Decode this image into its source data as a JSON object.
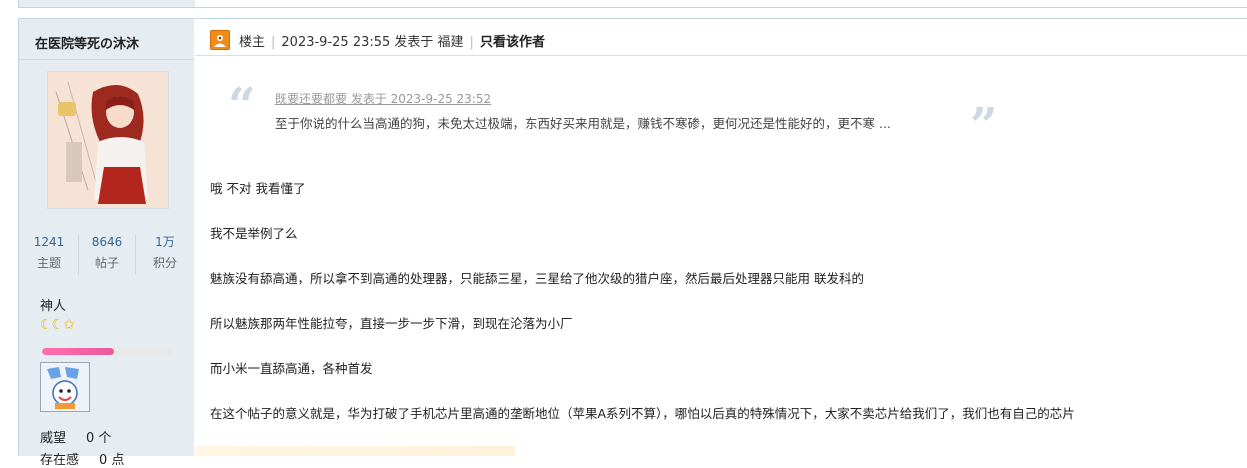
{
  "author": {
    "name": "在医院等死の沐沐",
    "stats": [
      {
        "value": "1241",
        "label": "主题"
      },
      {
        "value": "8646",
        "label": "帖子"
      },
      {
        "value": "1万",
        "label": "积分"
      }
    ],
    "rank": "神人",
    "rank_stars": "☾☾✩",
    "progress_percent": 55,
    "props": [
      {
        "label": "威望",
        "value": "0 个"
      },
      {
        "label": "存在感",
        "value": "0 点"
      }
    ]
  },
  "post": {
    "header": {
      "role": "楼主",
      "meta": "2023-9-25 23:55 发表于 福建",
      "only_author": "只看该作者"
    },
    "quote": {
      "source": "既要还要都要 发表于 2023-9-25 23:52",
      "text": "至于你说的什么当高通的狗，未免太过极端，东西好买来用就是，赚钱不寒碜，更何况还是性能好的，更不寒 ..."
    },
    "paragraphs": [
      "哦 不对 我看懂了",
      "我不是举例了么",
      "魅族没有舔高通，所以拿不到高通的处理器，只能舔三星，三星给了他次级的猎户座，然后最后处理器只能用 联发科的",
      "所以魅族那两年性能拉夸，直接一步一步下滑，到现在沦落为小厂",
      "而小米一直舔高通，各种首发",
      "在这个帖子的意义就是，华为打破了手机芯片里高通的垄断地位（苹果A系列不算），哪怕以后真的特殊情况下，大家不卖芯片给我们了，我们也有自己的芯片"
    ]
  },
  "colors": {
    "sidebar_bg": "#e5edf2",
    "border": "#c2d5e3",
    "link": "#336699",
    "louzhu_orange": "#f08d1a",
    "progress": "#e85a9c"
  }
}
